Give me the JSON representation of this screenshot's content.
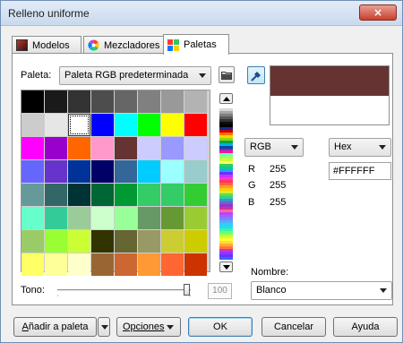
{
  "window": {
    "title": "Relleno uniforme",
    "close_glyph": "×"
  },
  "tabs": [
    {
      "label": "Modelos",
      "icon": "color-models-icon",
      "active": false
    },
    {
      "label": "Mezcladores",
      "icon": "color-wheel-icon",
      "active": false
    },
    {
      "label": "Paletas",
      "icon": "palette-grid-icon",
      "active": true
    }
  ],
  "palette": {
    "label": "Paleta:",
    "selected": "Paleta RGB predeterminada",
    "swatches": [
      "#000000",
      "#1a1a1a",
      "#333333",
      "#4d4d4d",
      "#666666",
      "#808080",
      "#999999",
      "#b3b3b3",
      "#cccccc",
      "#e6e6e6",
      "#ffffff",
      "#0000ff",
      "#00ffff",
      "#00ff00",
      "#ffff00",
      "#ff0000",
      "#ff00ff",
      "#9900cc",
      "#ff6600",
      "#ff99cc",
      "#663333",
      "#ccccff",
      "#9999ff",
      "#ccccff",
      "#6666ff",
      "#6633cc",
      "#003399",
      "#000066",
      "#336699",
      "#00ccff",
      "#99ffff",
      "#99cccc",
      "#669999",
      "#336666",
      "#003333",
      "#006633",
      "#009933",
      "#33cc66",
      "#33cc66",
      "#33cc33",
      "#66ffcc",
      "#33cc99",
      "#99cc99",
      "#ccffcc",
      "#99ff99",
      "#669966",
      "#669933",
      "#99cc33",
      "#99cc66",
      "#99ff33",
      "#ccff33",
      "#333300",
      "#666633",
      "#999966",
      "#cccc33",
      "#cccc00",
      "#ffff66",
      "#ffff99",
      "#ffffcc",
      "#996633",
      "#cc6633",
      "#ff9933",
      "#ff6633",
      "#cc3300"
    ],
    "selected_index": 10,
    "strip_colors": [
      "#ffffff",
      "#d9d9d9",
      "#a6a6a6",
      "#7f7f7f",
      "#595959",
      "#333333",
      "#0d0d0d",
      "#000000",
      "#1a2b8c",
      "#c40000",
      "#ff6f00",
      "#ffd500",
      "#9bd400",
      "#00a650",
      "#00b4d8",
      "#0047ab",
      "#7b2cbf",
      "#ff1493",
      "#66ffcc",
      "#99ff66",
      "#ccff33",
      "#ffff66",
      "#33cc66",
      "#00cc99",
      "#3399ff",
      "#6633ff",
      "#cc33ff",
      "#ff33cc",
      "#ff3366",
      "#ff6633",
      "#ff9933",
      "#ffcc00",
      "#ccee33",
      "#66dd33",
      "#33cc99",
      "#3399cc",
      "#6666cc",
      "#9933cc",
      "#cc3399",
      "#ff6699",
      "#bb44ff",
      "#9966ff",
      "#7788ff",
      "#55aaff",
      "#33ccff",
      "#22ddee",
      "#44eeaa",
      "#66ff77",
      "#99ff55",
      "#ccff33",
      "#ffff33",
      "#ffdd33",
      "#ffaa33",
      "#ff7733",
      "#cc33cc",
      "#9933ff",
      "#6633ff",
      "#3366ff"
    ]
  },
  "preview": {
    "new_color": "#663333",
    "old_color": "#ffffff"
  },
  "color_values": {
    "model": "RGB",
    "format": "Hex",
    "hex": "#FFFFFF",
    "r_label": "R",
    "r": "255",
    "g_label": "G",
    "g": "255",
    "b_label": "B",
    "b": "255"
  },
  "name": {
    "label": "Nombre:",
    "value": "Blanco"
  },
  "tint": {
    "label": "Tono:",
    "value": "100"
  },
  "footer": {
    "add_palette_label": "Añadir a paleta",
    "add_palette_underline": "A",
    "add_palette_rest": "ñadir a paleta",
    "options_label": "Opciones",
    "ok_label": "OK",
    "cancel_label": "Cancelar",
    "help_label": "Ayuda"
  }
}
